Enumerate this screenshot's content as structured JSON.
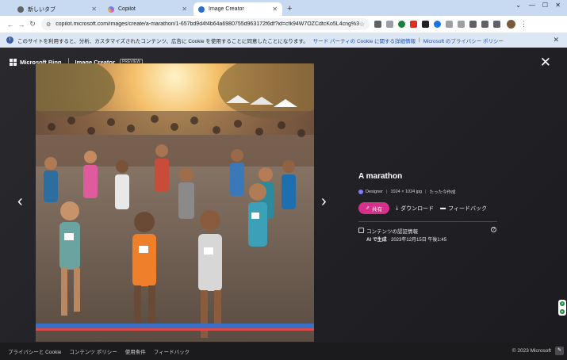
{
  "browser": {
    "tabs": [
      {
        "label": "新しいタブ",
        "favicon_color": "#5f6368",
        "active": false
      },
      {
        "label": "Copilot",
        "favicon_color": "#4f8cf7",
        "active": false
      },
      {
        "label": "Image Creator",
        "favicon_color": "#2b6fd6",
        "active": true
      }
    ],
    "new_tab_icon": "plus-icon",
    "window_controls": [
      "minimize",
      "maximize",
      "close"
    ],
    "url": "copilot.microsoft.com/images/create/a-marathon/1-657bd9d4f4b64a6980755d963172f6df?id=cfk94W7OZCdtcKo5L4cng%3d%3...",
    "extension_colors": [
      "#5f6368",
      "#5f6368",
      "#188038",
      "#d93025",
      "#202124",
      "#1a73e8",
      "#5f6368",
      "#5f6368",
      "#5f6368",
      "#5f6368"
    ]
  },
  "cookie_banner": {
    "text": "このサイトを利用すると、分析、カスタマイズされたコンテンツ、広告に Cookie を使用することに同意したことになります。",
    "link1": "サード パーティの Cookie に関する詳細情報",
    "separator": "|",
    "link2": "Microsoft のプライバシー ポリシー"
  },
  "header": {
    "brand": "Microsoft Bing",
    "product": "Image Creator",
    "badge": "PREVIEW"
  },
  "details": {
    "title": "A marathon",
    "creator": "Designer",
    "dimensions": "1024 × 1024 jpg",
    "time": "たった今作成",
    "share_label": "共有",
    "download_label": "ダウンロード",
    "feedback_label": "フィードバック",
    "credentials_label": "コンテンツの認証情報",
    "generated_by": "AI で生成",
    "date": "· 2023年12月15日 午後1:45"
  },
  "footer": {
    "links": [
      "プライバシーと Cookie",
      "コンテンツ ポリシー",
      "使用条件",
      "フィードバック"
    ],
    "copyright": "© 2023 Microsoft"
  }
}
